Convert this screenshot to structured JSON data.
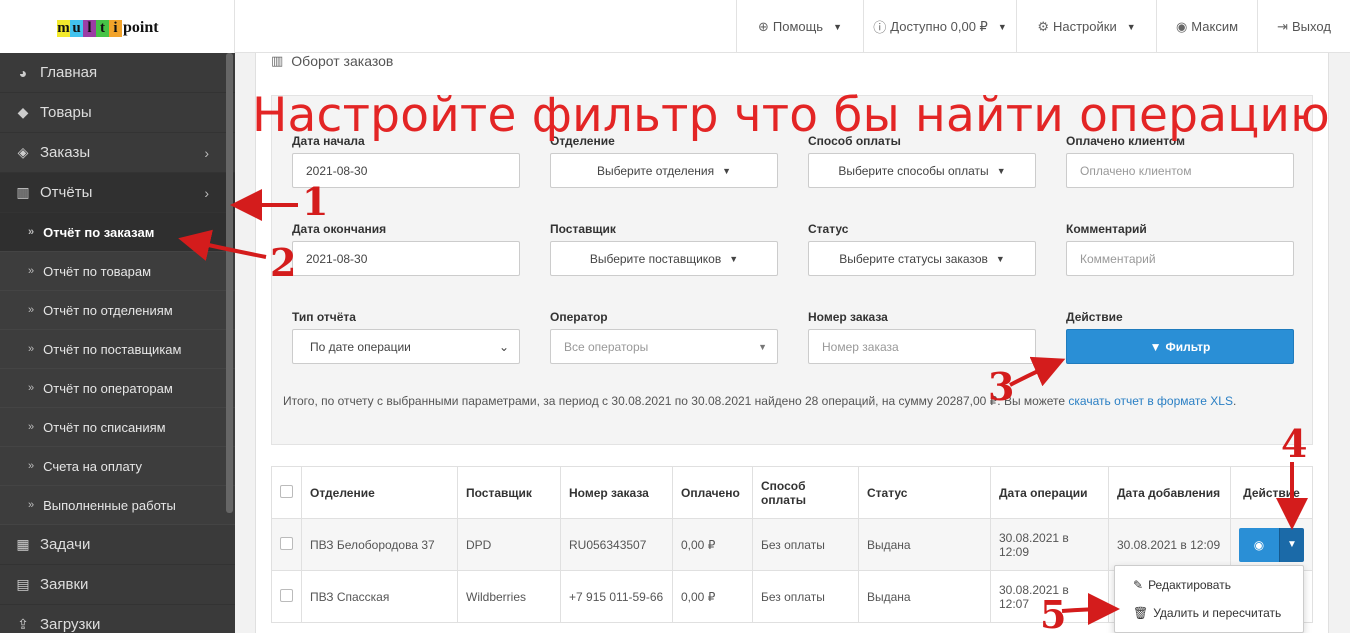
{
  "logo": {
    "letters": [
      "m",
      "u",
      "l",
      "t",
      "i"
    ],
    "letter_colors": [
      "#f3ea2d",
      "#42c3ef",
      "#9b3ea5",
      "#46c346",
      "#f2a32a"
    ],
    "suffix": "point"
  },
  "nav": {
    "help": "Помощь",
    "balance": "Доступно 0,00 ₽",
    "settings": "Настройки",
    "user": "Максим",
    "logout": "Выход"
  },
  "sidebar": {
    "items": [
      {
        "label": "Главная",
        "icon": "palette-icon"
      },
      {
        "label": "Товары",
        "icon": "tags-icon"
      },
      {
        "label": "Заказы",
        "icon": "cube-icon"
      },
      {
        "label": "Отчёты",
        "icon": "bar-chart-icon"
      }
    ],
    "subitems": [
      "Отчёт по заказам",
      "Отчёт по товарам",
      "Отчёт по отделениям",
      "Отчёт по поставщикам",
      "Отчёт по операторам",
      "Отчёт по списаниям",
      "Счета на оплату",
      "Выполненные работы"
    ],
    "bottom": [
      "Задачи",
      "Заявки",
      "Загрузки"
    ]
  },
  "panel": {
    "title": "Оборот заказов"
  },
  "annotation": {
    "title": "Настройте фильтр что бы найти операцию",
    "numbers": [
      "1",
      "2",
      "3",
      "4",
      "5"
    ],
    "color": "#d41c1c"
  },
  "filters": {
    "date_start_label": "Дата начала",
    "date_start_value": "2021-08-30",
    "date_end_label": "Дата окончания",
    "date_end_value": "2021-08-30",
    "report_type_label": "Тип отчёта",
    "report_type_value": "По дате операции",
    "branch_label": "Отделение",
    "branch_value": "Выберите отделения",
    "supplier_label": "Поставщик",
    "supplier_value": "Выберите поставщиков",
    "operator_label": "Оператор",
    "operator_value": "Все операторы",
    "payment_label": "Способ оплаты",
    "payment_value": "Выберите способы оплаты",
    "status_label": "Статус",
    "status_value": "Выберите статусы заказов",
    "order_number_label": "Номер заказа",
    "order_number_placeholder": "Номер заказа",
    "paid_label": "Оплачено клиентом",
    "paid_placeholder": "Оплачено клиентом",
    "comment_label": "Комментарий",
    "comment_placeholder": "Комментарий",
    "action_label": "Действие",
    "filter_button": "Фильтр"
  },
  "summary": {
    "text": "Итого, по отчету с выбранными параметрами, за период с 30.08.2021 по 30.08.2021 найдено 28 операций, на сумму 20287,00 ₽. Вы можете ",
    "link": "скачать отчет в формате XLS",
    "end": "."
  },
  "table": {
    "headers": [
      "Отделение",
      "Поставщик",
      "Номер заказа",
      "Оплачено",
      "Способ оплаты",
      "Статус",
      "Дата операции",
      "Дата добавления",
      "Действие"
    ],
    "rows": [
      [
        "ПВЗ Белобородова 37",
        "DPD",
        "RU056343507",
        "0,00 ₽",
        "Без оплаты",
        "Выдана",
        "30.08.2021 в 12:09",
        "30.08.2021 в 12:09"
      ],
      [
        "ПВЗ Спасская",
        "Wildberries",
        "+7 915 011-59-66",
        "0,00 ₽",
        "Без оплаты",
        "Выдана",
        "30.08.2021 в 12:07",
        ""
      ]
    ]
  },
  "dropdown_menu": {
    "edit": "Редактировать",
    "delete": "Удалить и пересчитать"
  }
}
